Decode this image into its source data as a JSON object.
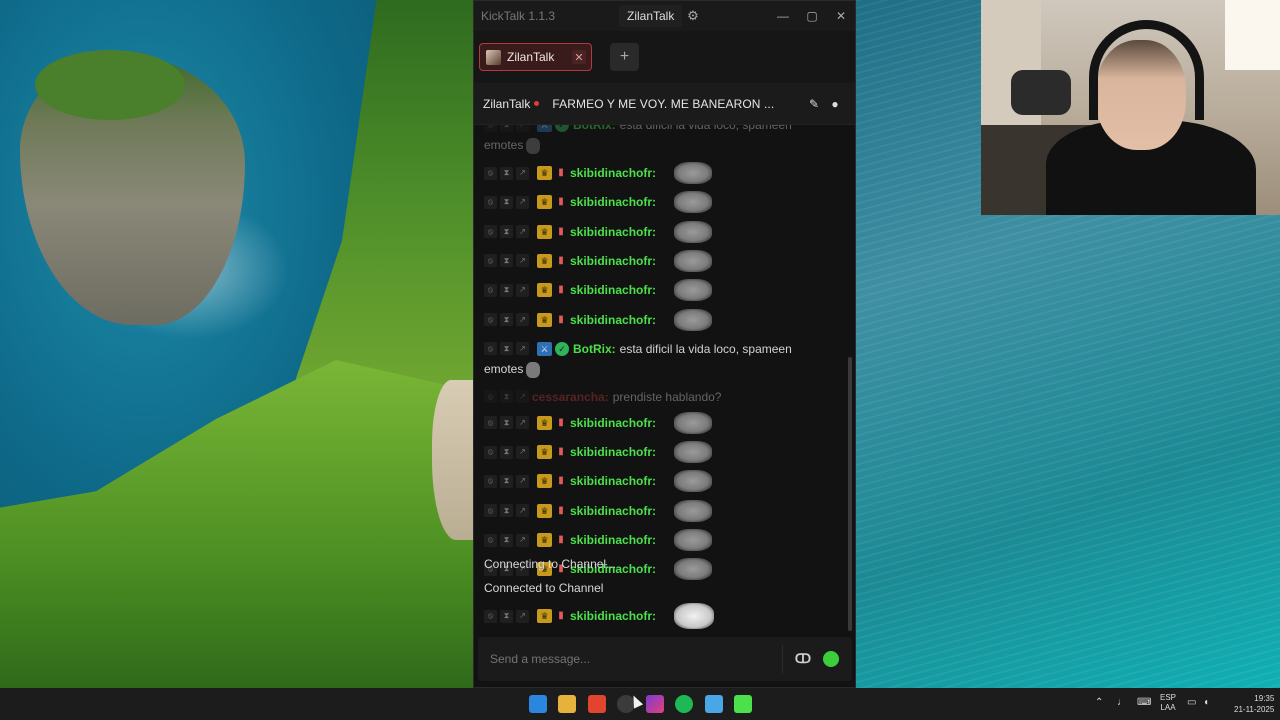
{
  "window": {
    "app_title": "KickTalk 1.1.3",
    "title_channel": "ZilanTalk",
    "gear_icon": "gear-icon",
    "controls": [
      "minimize-icon",
      "maximize-icon",
      "close-icon"
    ]
  },
  "tabs": [
    {
      "label": "ZilanTalk",
      "close": "✕",
      "active": true
    }
  ],
  "add_tab": "+",
  "channel": {
    "name": "ZilanTalk",
    "live": true,
    "stream_title": "FARMEO Y ME VOY. ME BANEARON ...",
    "icons": [
      "pin-icon",
      "user-icon"
    ]
  },
  "chat": {
    "messages": [
      {
        "type": "bot",
        "user": "BotRix:",
        "text": "esta dificil la vida loco, spameen",
        "cont": "emotes"
      },
      {
        "type": "emote",
        "user": "skibidinachofr:"
      },
      {
        "type": "emote",
        "user": "skibidinachofr:"
      },
      {
        "type": "emote",
        "user": "skibidinachofr:"
      },
      {
        "type": "emote",
        "user": "skibidinachofr:"
      },
      {
        "type": "emote",
        "user": "skibidinachofr:"
      },
      {
        "type": "emote",
        "user": "skibidinachofr:"
      },
      {
        "type": "bot",
        "user": "BotRix:",
        "text": "esta dificil la vida loco, spameen",
        "cont": "emotes"
      },
      {
        "type": "user",
        "user": "cessarancha:",
        "text": "prendiste hablando?"
      },
      {
        "type": "emote",
        "user": "skibidinachofr:"
      },
      {
        "type": "emote",
        "user": "skibidinachofr:"
      },
      {
        "type": "emote",
        "user": "skibidinachofr:"
      },
      {
        "type": "emote",
        "user": "skibidinachofr:"
      },
      {
        "type": "emote",
        "user": "skibidinachofr:"
      },
      {
        "type": "emote",
        "user": "skibidinachofr:"
      }
    ],
    "system_connecting": "Connecting to Channel...",
    "system_connected": "Connected to Channel",
    "latest_user": "skibidinachofr:"
  },
  "composer": {
    "placeholder": "Send a message..."
  },
  "taskbar": {
    "apps": [
      "windows-start-icon",
      "file-explorer-icon",
      "brave-icon",
      "obs-icon",
      "instagram-icon",
      "spotify-icon",
      "notepad-icon",
      "kick-icon"
    ],
    "lang_top": "ESP",
    "lang_bottom": "LAA",
    "time": "19:35",
    "date": "21-11-2025"
  },
  "colors": {
    "kick_green": "#4be14b",
    "tab_red": "#b23a3a",
    "username_red": "#b73a3a"
  }
}
